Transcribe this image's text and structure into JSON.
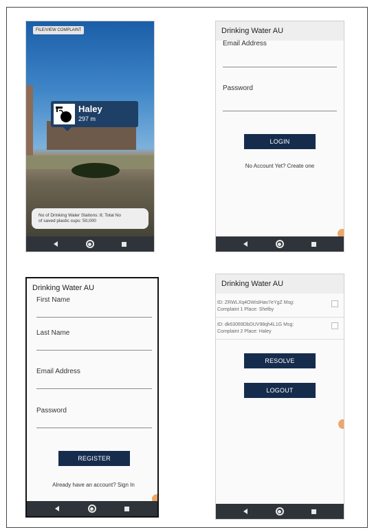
{
  "panel1": {
    "file_button": "FILE/VIEW COMPLAINT",
    "marker_name": "Haley",
    "marker_distance": "297 m",
    "info_line1": "No of Drinking Water Stations: 8; Total No",
    "info_line2": "of saved plastic cups: 50,000"
  },
  "panel2": {
    "title": "Drinking Water AU",
    "email_label": "Email Address",
    "password_label": "Password",
    "login_button": "LOGIN",
    "create_link": "No Account Yet? Create one"
  },
  "panel3": {
    "title": "Drinking Water AU",
    "first_name_label": "First Name",
    "last_name_label": "Last Name",
    "email_label": "Email Address",
    "password_label": "Password",
    "register_button": "REGISTER",
    "signin_link": "Already have an account? Sign In"
  },
  "panel4": {
    "title": "Drinking Water AU",
    "complaints": [
      {
        "line1": "ID: ZRWLXq4OWislHav7eYgZ Msg:",
        "line2": "Complaint 1 Place: Shelby"
      },
      {
        "line1": "ID: dk63069DbDUV98qh4L1G Msg:",
        "line2": "Complaint 2 Place: Haley"
      }
    ],
    "resolve_button": "RESOLVE",
    "logout_button": "LOGOUT"
  },
  "icons": [
    "back-icon",
    "home-icon",
    "recent-apps-icon",
    "water-fountain-icon",
    "checkbox-icon"
  ],
  "colors": {
    "button": "#162c4d",
    "navbar": "#2e3439",
    "fab": "#f0a66a"
  }
}
